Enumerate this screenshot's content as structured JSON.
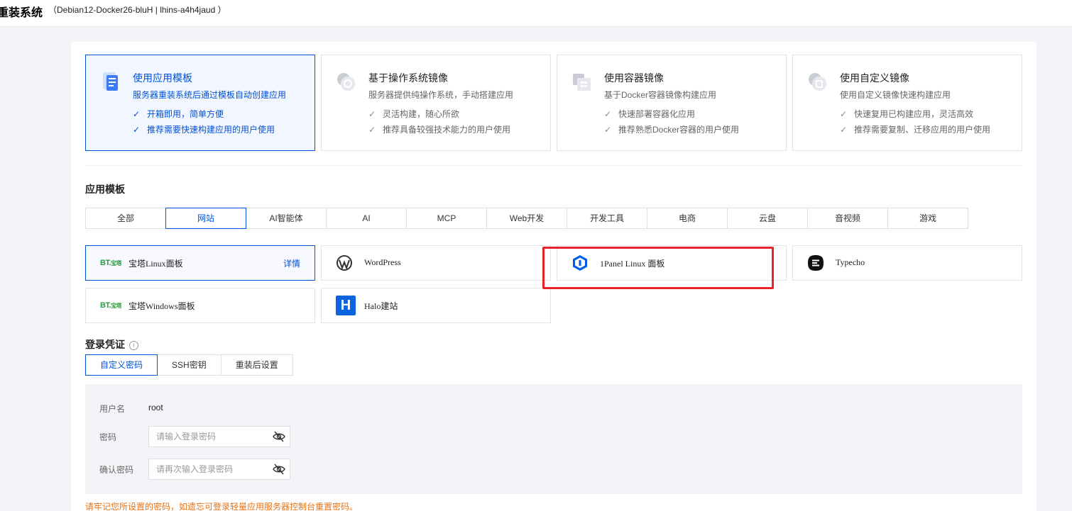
{
  "header": {
    "title": "重装系统",
    "subtitle": "（Debian12-Docker26-bluH | lhins-a4h4jaud ）"
  },
  "modes": [
    {
      "title": "使用应用模板",
      "desc": "服务器重装系统后通过模板自动创建应用",
      "features": [
        "开箱即用，简单方便",
        "推荐需要快速构建应用的用户使用"
      ],
      "icon": "app-template-icon"
    },
    {
      "title": "基于操作系统镜像",
      "desc": "服务器提供纯操作系统，手动搭建应用",
      "features": [
        "灵活构建，随心所欲",
        "推荐具备较强技术能力的用户使用"
      ],
      "icon": "os-image-icon"
    },
    {
      "title": "使用容器镜像",
      "desc": "基于Docker容器镜像构建应用",
      "features": [
        "快速部署容器化应用",
        "推荐熟悉Docker容器的用户使用"
      ],
      "icon": "container-image-icon"
    },
    {
      "title": "使用自定义镜像",
      "desc": "使用自定义镜像快速构建应用",
      "features": [
        "快速复用已构建应用，灵活高效",
        "推荐需要复制、迁移应用的用户使用"
      ],
      "icon": "custom-image-icon"
    }
  ],
  "templates": {
    "title": "应用模板",
    "tabs": [
      "全部",
      "网站",
      "AI智能体",
      "AI",
      "MCP",
      "Web开发",
      "开发工具",
      "电商",
      "云盘",
      "音视频",
      "游戏"
    ],
    "active_tab": "网站",
    "apps": [
      {
        "name": "宝塔Linux面板",
        "icon_text": "BT.",
        "icon": "bt-panel-icon",
        "detail": "详情"
      },
      {
        "name": "WordPress",
        "icon": "wordpress-icon"
      },
      {
        "name": "1Panel Linux 面板",
        "icon": "1panel-icon"
      },
      {
        "name": "Typecho",
        "icon": "typecho-icon"
      },
      {
        "name": "宝塔Windows面板",
        "icon_text": "BT.",
        "icon": "bt-panel-icon"
      },
      {
        "name": "Halo建站",
        "icon_text": "H",
        "icon": "halo-icon"
      }
    ]
  },
  "login": {
    "title": "登录凭证",
    "tabs": [
      "自定义密码",
      "SSH密钥",
      "重装后设置"
    ],
    "active_tab": "自定义密码",
    "username_label": "用户名",
    "username_value": "root",
    "password_label": "密码",
    "password_placeholder": "请输入登录密码",
    "confirm_label": "确认密码",
    "confirm_placeholder": "请再次输入登录密码",
    "warning": "请牢记您所设置的密码，如遗忘可登录轻量应用服务器控制台重置密码。"
  },
  "colors": {
    "accent": "#0052d9",
    "highlight": "#e5252a",
    "warning": "#e37318",
    "bt_green": "#2a9a3d"
  }
}
